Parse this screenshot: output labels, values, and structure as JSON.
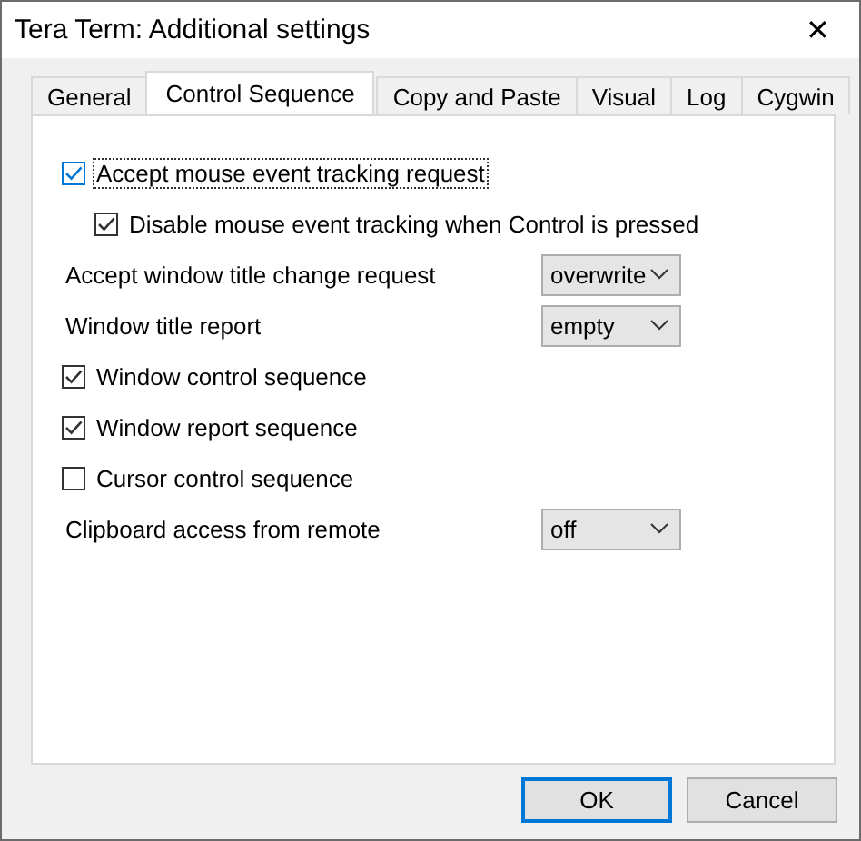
{
  "window": {
    "title": "Tera Term: Additional settings",
    "close": "✕"
  },
  "tabs": [
    {
      "label": "General",
      "selected": false
    },
    {
      "label": "Control Sequence",
      "selected": true
    },
    {
      "label": "Copy and Paste",
      "selected": false
    },
    {
      "label": "Visual",
      "selected": false
    },
    {
      "label": "Log",
      "selected": false
    },
    {
      "label": "Cygwin",
      "selected": false
    }
  ],
  "settings": [
    {
      "kind": "checkbox",
      "label": "Accept mouse event tracking request",
      "checked": true,
      "focused": true,
      "children": [
        {
          "kind": "checkbox",
          "label": "Disable mouse event tracking when Control is pressed",
          "checked": true,
          "focused": false
        }
      ]
    },
    {
      "kind": "select",
      "label": "Accept window title change request",
      "value": "overwrite"
    },
    {
      "kind": "select",
      "label": "Window title report",
      "value": "empty"
    },
    {
      "kind": "checkbox",
      "label": "Window control sequence",
      "checked": true,
      "focused": false
    },
    {
      "kind": "checkbox",
      "label": "Window report sequence",
      "checked": true,
      "focused": false
    },
    {
      "kind": "checkbox",
      "label": "Cursor control sequence",
      "checked": false,
      "focused": false
    },
    {
      "kind": "select",
      "label": "Clipboard access from remote",
      "value": "off"
    }
  ],
  "buttons": [
    {
      "label": "OK",
      "default": true
    },
    {
      "label": "Cancel",
      "default": false
    }
  ]
}
